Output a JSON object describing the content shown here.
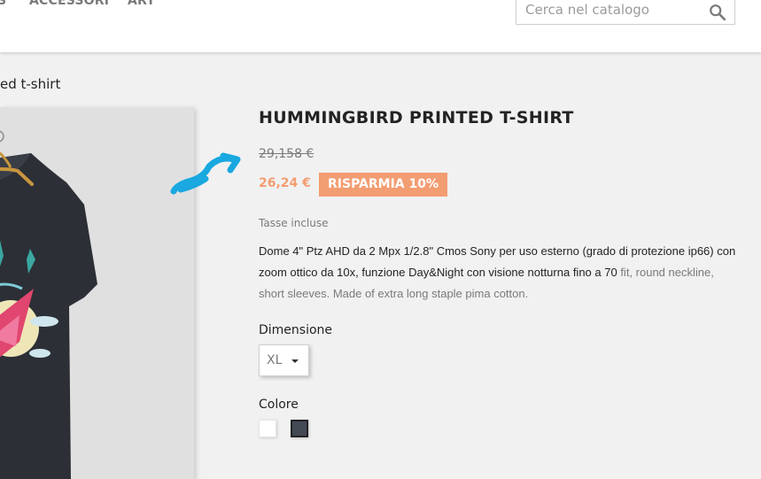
{
  "nav": {
    "items": [
      {
        "label": "S"
      },
      {
        "label": "ACCESSORI"
      },
      {
        "label": "ART"
      }
    ]
  },
  "search": {
    "placeholder": "Cerca nel catalogo",
    "value": ""
  },
  "breadcrumb": {
    "current": "ed t-shirt"
  },
  "product": {
    "title": "HUMMINGBIRD PRINTED T-SHIRT",
    "old_price": "29,158 €",
    "price": "26,24 €",
    "discount": "RISPARMIA 10%",
    "tax_note": "Tasse incluse",
    "description_dark": "Dome 4\" Ptz AHD da 2 Mpx 1/2.8\" Cmos Sony per uso esterno (grado di protezione ip66) con zoom ottico da 10x, funzione Day&Night con visione notturna fino a 70",
    "description_light": " fit, round neckline, short sleeves. Made of extra long staple pima cotton.",
    "size_label": "Dimensione",
    "size_selected": "XL",
    "color_label": "Colore",
    "colors": [
      {
        "name": "white",
        "hex": "#ffffff"
      },
      {
        "name": "black",
        "hex": "#434a54"
      }
    ]
  },
  "theme": {
    "accent": "#f39d72",
    "annotation": "#19a8e0",
    "text": "#232323",
    "muted": "#7a7a7a"
  }
}
